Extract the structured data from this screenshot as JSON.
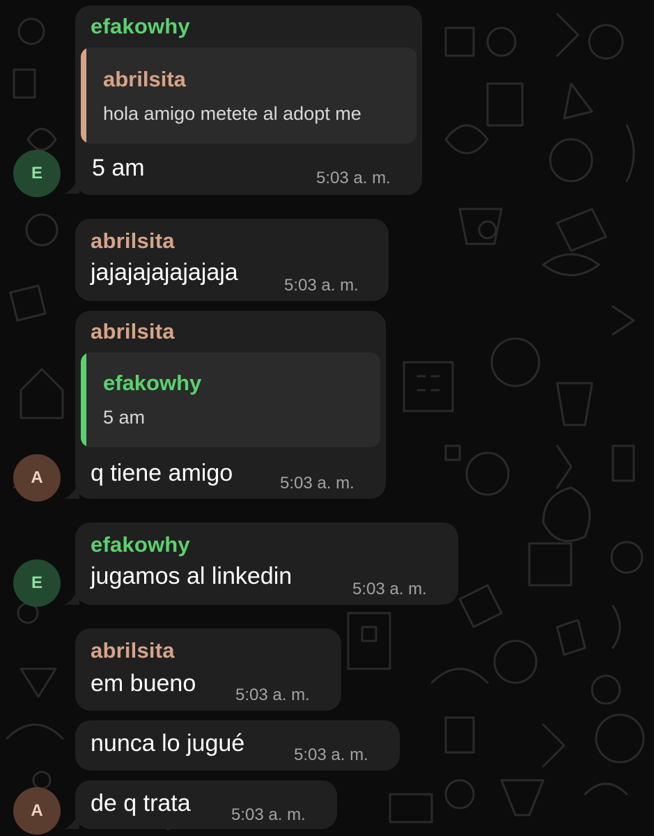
{
  "colors": {
    "background": "#0c0c0c",
    "bubble": "#202020",
    "quote_background": "#2b2b2b",
    "efakowhy_name": "#5bd16f",
    "abrilsita_name": "#d6a487",
    "timestamp": "#a3a3a3",
    "message_text": "#ffffff"
  },
  "avatars": {
    "efakowhy": "E",
    "abrilsita": "A"
  },
  "messages": [
    {
      "sender": "efakowhy",
      "reply_to": {
        "sender": "abrilsita",
        "text": "hola amigo metete al adopt me"
      },
      "text": "5 am",
      "time": "5:03 a. m."
    },
    {
      "sender": "abrilsita",
      "text": "jajajajajajajaja",
      "time": "5:03 a. m."
    },
    {
      "sender": "abrilsita",
      "reply_to": {
        "sender": "efakowhy",
        "text": "5 am"
      },
      "text": "q tiene amigo",
      "time": "5:03 a. m."
    },
    {
      "sender": "efakowhy",
      "text": "jugamos al linkedin",
      "time": "5:03 a. m."
    },
    {
      "sender": "abrilsita",
      "text": "em bueno",
      "time": "5:03 a. m."
    },
    {
      "text": "nunca lo jugué",
      "time": "5:03 a. m."
    },
    {
      "text": "de q trata",
      "time": "5:03 a. m."
    }
  ]
}
